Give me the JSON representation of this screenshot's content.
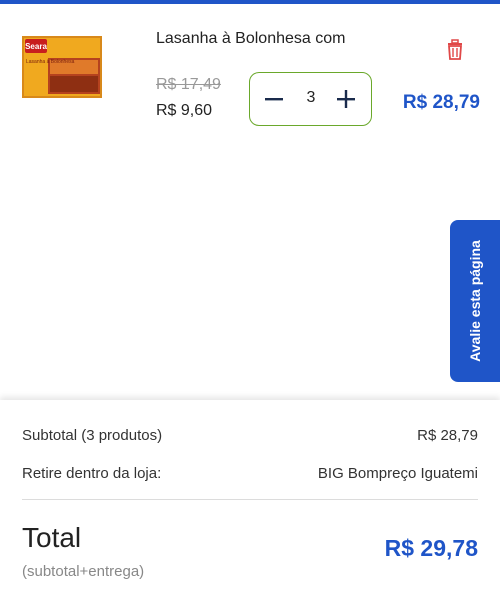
{
  "theme": {
    "accent": "#1f55c8",
    "stepper_border": "#6aa82b",
    "trash_color": "#e04848"
  },
  "cart": {
    "item": {
      "title": "Lasanha à Bolonhesa com",
      "old_price": "R$ 17,49",
      "new_price": "R$ 9,60",
      "quantity": "3",
      "line_total": "R$ 28,79",
      "image": {
        "brand_text": "Seara",
        "product_text": "Lasanha à Bolonhesa"
      }
    }
  },
  "feedback_tab": {
    "label": "Avalie esta página"
  },
  "summary": {
    "subtotal_label": "Subtotal (3 produtos)",
    "subtotal_value": "R$ 28,79",
    "pickup_label": "Retire dentro da loja:",
    "pickup_value": "BIG Bompreço Iguatemi",
    "total_label": "Total",
    "total_sub": "(subtotal+entrega)",
    "total_value": "R$ 29,78"
  }
}
